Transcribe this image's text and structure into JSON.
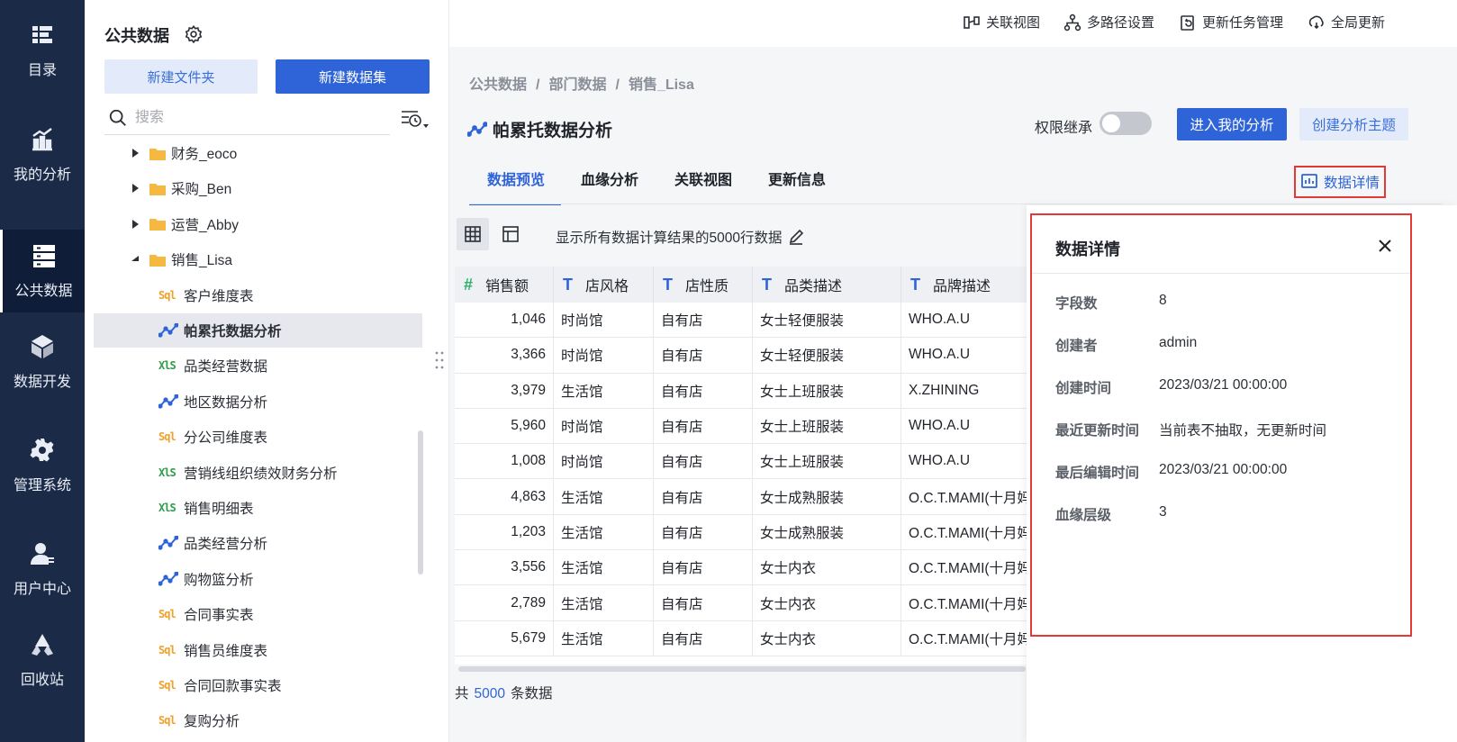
{
  "nav": {
    "items": [
      {
        "label": "目录",
        "icon": "catalog-icon"
      },
      {
        "label": "我的分析",
        "icon": "analysis-icon"
      },
      {
        "label": "公共数据",
        "icon": "public-data-icon"
      },
      {
        "label": "数据开发",
        "icon": "cube-icon"
      },
      {
        "label": "管理系统",
        "icon": "gear-icon"
      },
      {
        "label": "用户中心",
        "icon": "user-icon"
      },
      {
        "label": "回收站",
        "icon": "recycle-icon"
      }
    ],
    "active_index": 2
  },
  "tree": {
    "title": "公共数据",
    "new_folder": "新建文件夹",
    "new_dataset": "新建数据集",
    "search_placeholder": "搜索",
    "items": [
      {
        "type": "folder",
        "label": "财务_eoco",
        "expanded": false
      },
      {
        "type": "folder",
        "label": "采购_Ben",
        "expanded": false
      },
      {
        "type": "folder",
        "label": "运营_Abby",
        "expanded": false
      },
      {
        "type": "folder",
        "label": "销售_Lisa",
        "expanded": true
      },
      {
        "type": "sql",
        "label": "客户维度表"
      },
      {
        "type": "analysis",
        "label": "帕累托数据分析",
        "selected": true
      },
      {
        "type": "xls",
        "label": "品类经营数据"
      },
      {
        "type": "analysis",
        "label": "地区数据分析"
      },
      {
        "type": "sql",
        "label": "分公司维度表"
      },
      {
        "type": "xls",
        "label": "营销线组织绩效财务分析"
      },
      {
        "type": "xls",
        "label": "销售明细表"
      },
      {
        "type": "analysis",
        "label": "品类经营分析"
      },
      {
        "type": "analysis",
        "label": "购物篮分析"
      },
      {
        "type": "sql",
        "label": "合同事实表"
      },
      {
        "type": "sql",
        "label": "销售员维度表"
      },
      {
        "type": "sql",
        "label": "合同回款事实表"
      },
      {
        "type": "sql",
        "label": "复购分析"
      }
    ]
  },
  "topbar": {
    "actions": [
      {
        "label": "关联视图",
        "icon": "relation-view-icon"
      },
      {
        "label": "多路径设置",
        "icon": "multi-path-icon"
      },
      {
        "label": "更新任务管理",
        "icon": "update-task-icon"
      },
      {
        "label": "全局更新",
        "icon": "global-update-icon"
      }
    ]
  },
  "main": {
    "breadcrumb": [
      "公共数据",
      "部门数据",
      "销售_Lisa"
    ],
    "title": "帕累托数据分析",
    "perm_label": "权限继承",
    "perm_on": false,
    "enter_button": "进入我的分析",
    "create_topic_button": "创建分析主题",
    "tabs": [
      "数据预览",
      "血缘分析",
      "关联视图",
      "更新信息"
    ],
    "active_tab": 0,
    "detail_button": "数据详情",
    "rows_note": "显示所有数据计算结果的5000行数据",
    "total_prefix": "共",
    "total_count": "5000",
    "total_suffix": "条数据"
  },
  "table": {
    "columns": [
      {
        "name": "销售额",
        "type": "number"
      },
      {
        "name": "店风格",
        "type": "text"
      },
      {
        "name": "店性质",
        "type": "text"
      },
      {
        "name": "品类描述",
        "type": "text"
      },
      {
        "name": "品牌描述",
        "type": "text"
      }
    ],
    "rows": [
      [
        "1,046",
        "时尚馆",
        "自有店",
        "女士轻便服装",
        "WHO.A.U"
      ],
      [
        "3,366",
        "时尚馆",
        "自有店",
        "女士轻便服装",
        "WHO.A.U"
      ],
      [
        "3,979",
        "生活馆",
        "自有店",
        "女士上班服装",
        "X.ZHINING"
      ],
      [
        "5,960",
        "时尚馆",
        "自有店",
        "女士上班服装",
        "WHO.A.U"
      ],
      [
        "1,008",
        "时尚馆",
        "自有店",
        "女士上班服装",
        "WHO.A.U"
      ],
      [
        "4,863",
        "生活馆",
        "自有店",
        "女士成熟服装",
        "O.C.T.MAMI(十月妈"
      ],
      [
        "1,203",
        "生活馆",
        "自有店",
        "女士成熟服装",
        "O.C.T.MAMI(十月妈"
      ],
      [
        "3,556",
        "生活馆",
        "自有店",
        "女士内衣",
        "O.C.T.MAMI(十月妈"
      ],
      [
        "2,789",
        "生活馆",
        "自有店",
        "女士内衣",
        "O.C.T.MAMI(十月妈"
      ],
      [
        "5,679",
        "生活馆",
        "自有店",
        "女士内衣",
        "O.C.T.MAMI(十月妈"
      ]
    ]
  },
  "detail": {
    "title": "数据详情",
    "fields": [
      {
        "label": "字段数",
        "value": "8"
      },
      {
        "label": "创建者",
        "value": "admin"
      },
      {
        "label": "创建时间",
        "value": "2023/03/21 00:00:00"
      },
      {
        "label": "最近更新时间",
        "value": "当前表不抽取，无更新时间"
      },
      {
        "label": "最后编辑时间",
        "value": "2023/03/21 00:00:00"
      },
      {
        "label": "血缘层级",
        "value": "3"
      }
    ]
  },
  "colors": {
    "nav_bg": "#1b2a47",
    "primary": "#2e64d8",
    "highlight_border": "#e53935"
  }
}
